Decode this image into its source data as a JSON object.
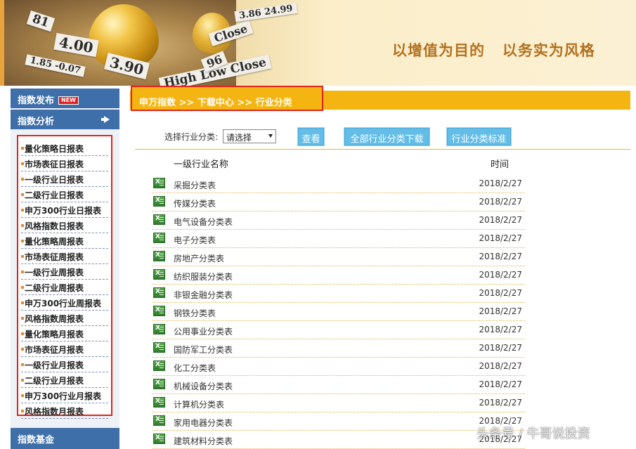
{
  "banner": {
    "slogan": "以增值为目的   以务实为风格",
    "tickers": [
      "81",
      "4.00",
      "3.90",
      "Close",
      "High  Low  Close",
      "1.85  -0.07",
      "3.86  24.99",
      "96"
    ]
  },
  "sidebar": {
    "publish_label": "指数发布",
    "new_badge": "NEW",
    "analysis_label": "指数分析",
    "fund_label": "指数基金",
    "reports": [
      "量化策略日报表",
      "市场表征日报表",
      "一级行业日报表",
      "二级行业日报表",
      "申万300行业日报表",
      "风格指数日报表",
      "量化策略周报表",
      "市场表征周报表",
      "一级行业周报表",
      "二级行业周报表",
      "申万300行业周报表",
      "风格指数周报表",
      "量化策略月报表",
      "市场表征月报表",
      "一级行业月报表",
      "二级行业月报表",
      "申万300行业月报表",
      "风格指数月报表"
    ]
  },
  "breadcrumb": "申万指数 >> 下载中心 >> 行业分类",
  "filter": {
    "label": "选择行业分类:",
    "select_value": "请选择",
    "view_button": "查看",
    "download_all_button": "全部行业分类下载",
    "standard_button": "行业分类标准"
  },
  "table": {
    "col_name": "一级行业名称",
    "col_time": "时间",
    "rows": [
      {
        "name": "采掘分类表",
        "date": "2018/2/27"
      },
      {
        "name": "传媒分类表",
        "date": "2018/2/27"
      },
      {
        "name": "电气设备分类表",
        "date": "2018/2/27"
      },
      {
        "name": "电子分类表",
        "date": "2018/2/27"
      },
      {
        "name": "房地产分类表",
        "date": "2018/2/27"
      },
      {
        "name": "纺织服装分类表",
        "date": "2018/2/27"
      },
      {
        "name": "非银金融分类表",
        "date": "2018/2/27"
      },
      {
        "name": "钢铁分类表",
        "date": "2018/2/27"
      },
      {
        "name": "公用事业分类表",
        "date": "2018/2/27"
      },
      {
        "name": "国防军工分类表",
        "date": "2018/2/27"
      },
      {
        "name": "化工分类表",
        "date": "2018/2/27"
      },
      {
        "name": "机械设备分类表",
        "date": "2018/2/27"
      },
      {
        "name": "计算机分类表",
        "date": "2018/2/27"
      },
      {
        "name": "家用电器分类表",
        "date": "2018/2/27"
      },
      {
        "name": "建筑材料分类表",
        "date": "2018/2/27"
      }
    ]
  },
  "watermark": "头条号 / 牛哥说投资",
  "colors": {
    "accent_gold": "#f4b411",
    "nav_blue": "#3f6fa9",
    "button_blue": "#63bde7",
    "highlight_red": "#e0251d",
    "slogan_brown": "#b3711f"
  },
  "icons": {
    "row_file": "excel-file-icon",
    "nav_arrow": "arrow-right-icon"
  }
}
